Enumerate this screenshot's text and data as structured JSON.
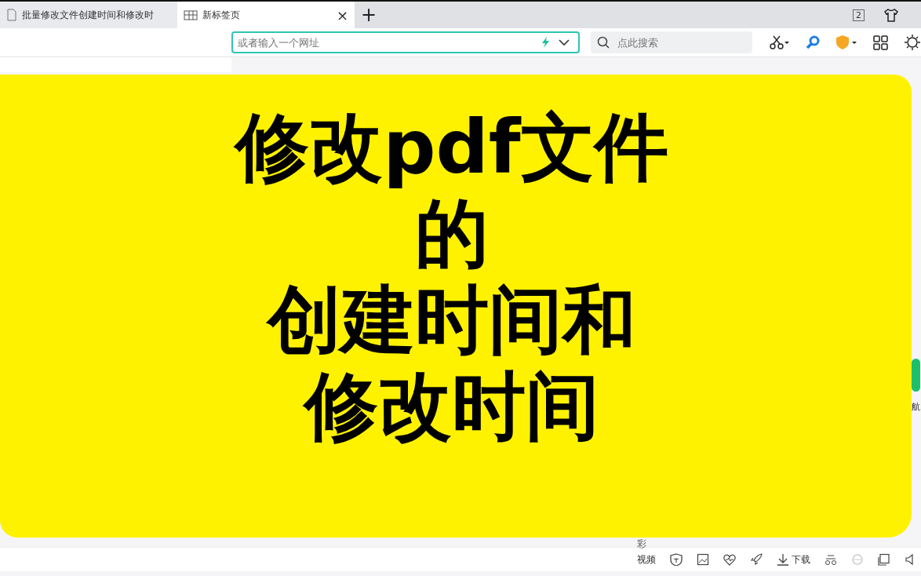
{
  "tabs": [
    {
      "title": "批量修改文件创建时间和修改时",
      "selected": false
    },
    {
      "title": "新标签页",
      "selected": true,
      "close": "×"
    }
  ],
  "new_tab": "+",
  "tab_count": "2",
  "address_bar": {
    "placeholder": "或者输入一个网址"
  },
  "search": {
    "placeholder": "点此搜索"
  },
  "overlay": {
    "lines": [
      "修改pdf文件",
      "的",
      "创建时间和",
      "修改时间"
    ]
  },
  "side_item": {
    "label": "航"
  },
  "bottom_bar": {
    "partial_label": "彩",
    "items": [
      {
        "kind": "text",
        "label": "视频"
      },
      {
        "kind": "shield"
      },
      {
        "kind": "image"
      },
      {
        "kind": "heart"
      },
      {
        "kind": "rocket"
      },
      {
        "kind": "download",
        "label": "下载"
      },
      {
        "kind": "glasses"
      },
      {
        "kind": "browser"
      },
      {
        "kind": "window"
      },
      {
        "kind": "speaker"
      }
    ]
  }
}
